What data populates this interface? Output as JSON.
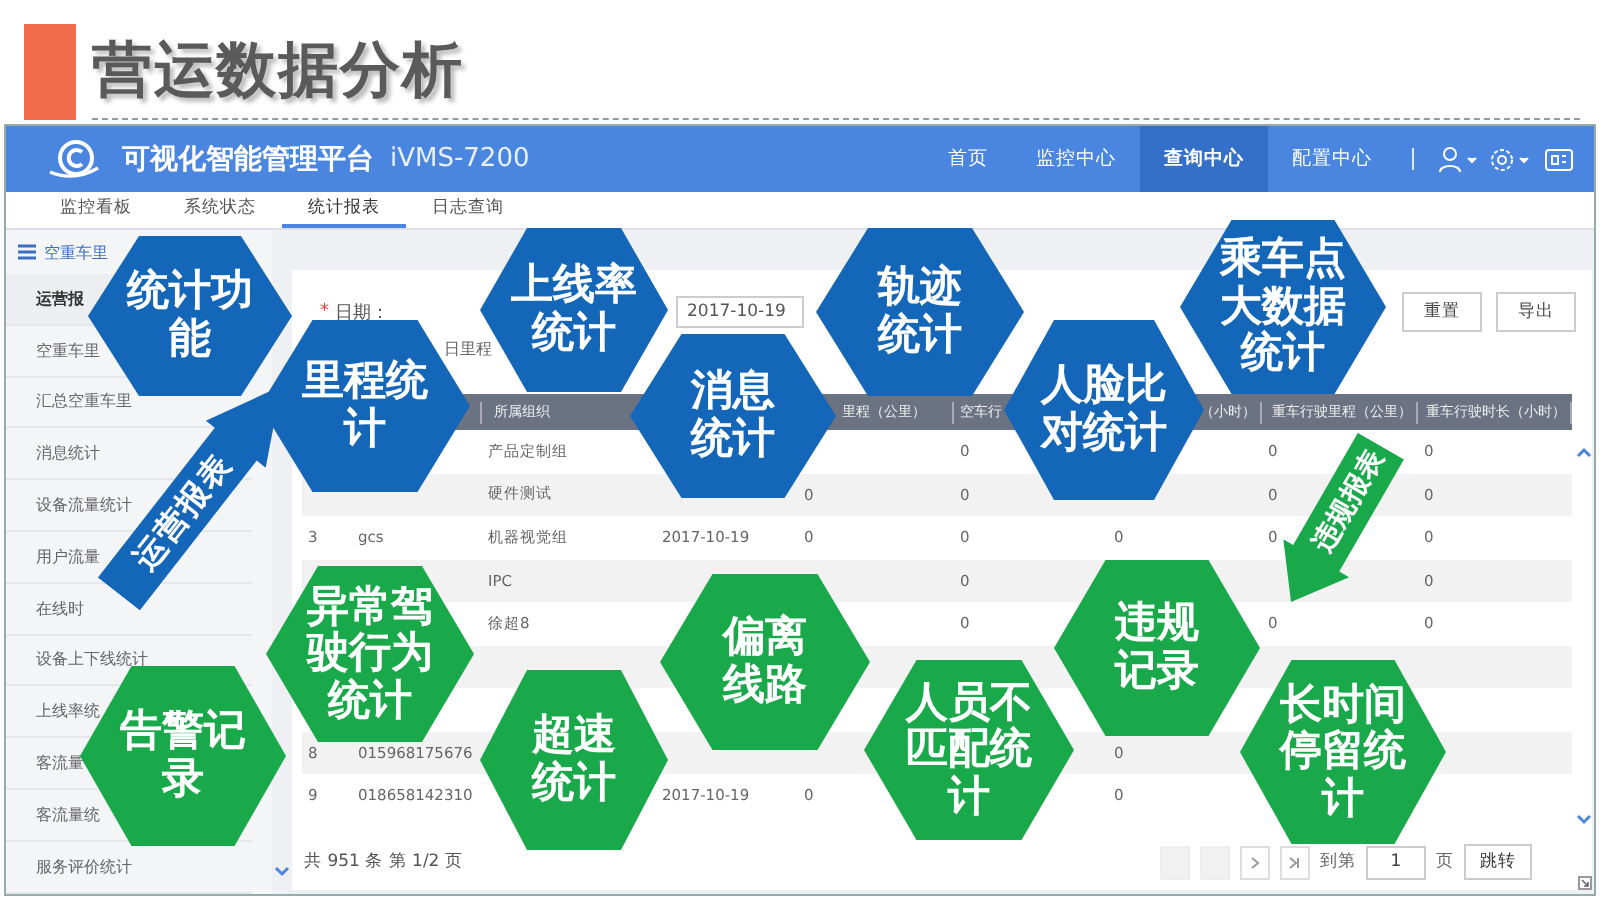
{
  "slide": {
    "title": "营运数据分析"
  },
  "app": {
    "title": "可视化智能管理平台",
    "model": "iVMS-7200",
    "nav": [
      {
        "label": "首页",
        "selected": false
      },
      {
        "label": "监控中心",
        "selected": false
      },
      {
        "label": "查询中心",
        "selected": true
      },
      {
        "label": "配置中心",
        "selected": false
      }
    ],
    "tabs": [
      {
        "label": "监控看板",
        "selected": false
      },
      {
        "label": "系统状态",
        "selected": false
      },
      {
        "label": "统计报表",
        "selected": true
      },
      {
        "label": "日志查询",
        "selected": false
      }
    ],
    "sidebar": {
      "header": "空重车里",
      "items": [
        {
          "label": "运营报",
          "selected": true
        },
        {
          "label": "空重车里",
          "selected": false
        },
        {
          "label": "汇总空重车里",
          "selected": false
        },
        {
          "label": "消息统计",
          "selected": false
        },
        {
          "label": "设备流量统计",
          "selected": false
        },
        {
          "label": "用户流量",
          "selected": false
        },
        {
          "label": "在线时",
          "selected": false
        },
        {
          "label": "设备上下线统计",
          "selected": false
        },
        {
          "label": "上线率统",
          "selected": false
        },
        {
          "label": "客流量",
          "selected": false
        },
        {
          "label": "客流量统",
          "selected": false
        },
        {
          "label": "服务评价统计",
          "selected": false
        }
      ]
    },
    "filter": {
      "required_mark": "*",
      "label": "日期：",
      "value": "2017-10-19",
      "option": "日里程"
    },
    "buttons": [
      "重置",
      "导出"
    ],
    "table": {
      "header": {
        "column_3": "所属组织",
        "column_5": "里程（公里）",
        "column_6": "空车行",
        "column_7": "（小时）",
        "column_8": "重车行驶里程（公里）",
        "column_9": "重车行驶时长（小时）"
      },
      "rows": [
        {
          "column_3": "产品定制组",
          "column_6": "0",
          "column_8": "0",
          "column_9": "0"
        },
        {
          "column_3": "硬件测试",
          "column_5": "0",
          "column_6": "0",
          "column_8": "0",
          "column_9": "0"
        },
        {
          "column_1": "3",
          "column_2": "gcs",
          "column_3": "机器视觉组",
          "column_4": "2017-10-19",
          "column_5": "0",
          "column_6": "0",
          "column_7": "0",
          "column_8": "0",
          "column_9": "0"
        },
        {
          "column_3": "IPC",
          "column_6": "0",
          "column_9": "0"
        },
        {
          "column_3": "徐超8",
          "column_6": "0",
          "column_8": "0",
          "column_9": "0"
        },
        {},
        {},
        {
          "column_1": "8",
          "column_2": "015968175676",
          "column_7": "0"
        },
        {
          "column_1": "9",
          "column_2": "018658142310",
          "column_4": "2017-10-19",
          "column_5": "0",
          "column_7": "0"
        }
      ]
    },
    "footer": {
      "summary": "共 951 条 第 1/2 页",
      "pager": [
        {
          "kind": "first",
          "disabled": true
        },
        {
          "kind": "prev",
          "disabled": true
        },
        {
          "kind": "next",
          "disabled": false
        },
        {
          "kind": "last",
          "disabled": false
        }
      ],
      "goto_label": "到第",
      "page": "1",
      "page_unit": "页",
      "jump": "跳转"
    }
  },
  "overlay": {
    "hexagons": [
      {
        "lines": [
          "统计功",
          "能"
        ],
        "color": "#1466b8"
      },
      {
        "lines": [
          "里程统",
          "计"
        ],
        "color": "#1466b8"
      },
      {
        "lines": [
          "上线率",
          "统计"
        ],
        "color": "#1466b8"
      },
      {
        "lines": [
          "消息",
          "统计"
        ],
        "color": "#1466b8"
      },
      {
        "lines": [
          "轨迹",
          "统计"
        ],
        "color": "#1466b8"
      },
      {
        "lines": [
          "人脸比",
          "对统计"
        ],
        "color": "#1466b8"
      },
      {
        "lines": [
          "乘车点",
          "大数据",
          "统计"
        ],
        "color": "#1466b8"
      },
      {
        "lines": [
          "告警记",
          "录"
        ],
        "color": "#19a84a"
      },
      {
        "lines": [
          "异常驾",
          "驶行为",
          "统计"
        ],
        "color": "#19a84a"
      },
      {
        "lines": [
          "超速",
          "统计"
        ],
        "color": "#19a84a"
      },
      {
        "lines": [
          "偏离",
          "线路"
        ],
        "color": "#19a84a"
      },
      {
        "lines": [
          "人员不",
          "匹配统",
          "计"
        ],
        "color": "#19a84a"
      },
      {
        "lines": [
          "违规",
          "记录"
        ],
        "color": "#19a84a"
      },
      {
        "lines": [
          "长时间",
          "停留统",
          "计"
        ],
        "color": "#19a84a"
      }
    ],
    "arrows": [
      {
        "label": "运营报表",
        "color": "#1466b8"
      },
      {
        "label": "违规报表",
        "color": "#19a84a"
      }
    ]
  }
}
